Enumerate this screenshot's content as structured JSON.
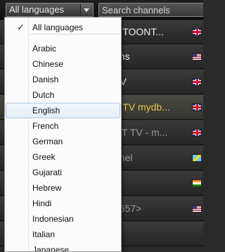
{
  "toolbar": {
    "language_select": {
      "value": "All languages"
    },
    "search": {
      "placeholder": "Search channels"
    }
  },
  "channels": [
    {
      "name": "A TOONT...",
      "flag": "uk"
    },
    {
      "name": "ons",
      "flag": "us"
    },
    {
      "name": "TV",
      "flag": "uk"
    },
    {
      "name": "Z TV mydb...",
      "flag": "uk",
      "highlight": true
    },
    {
      "name": "GT TV - m...",
      "flag": "uk",
      "dim": true
    },
    {
      "name": "nnel",
      "flag": "lc",
      "dim": true
    },
    {
      "name": "",
      "flag": "in"
    },
    {
      "name": "0657>",
      "flag": "us",
      "dim": true
    },
    {
      "name": "",
      "flag": ""
    }
  ],
  "dropdown": {
    "checked_item": "All languages",
    "hover_item": "English",
    "items": [
      "All languages",
      "Arabic",
      "Chinese",
      "Danish",
      "Dutch",
      "English",
      "French",
      "German",
      "Greek",
      "Gujarati",
      "Hebrew",
      "Hindi",
      "Indonesian",
      "Italian",
      "Japanese"
    ],
    "check_glyph": "✓"
  }
}
